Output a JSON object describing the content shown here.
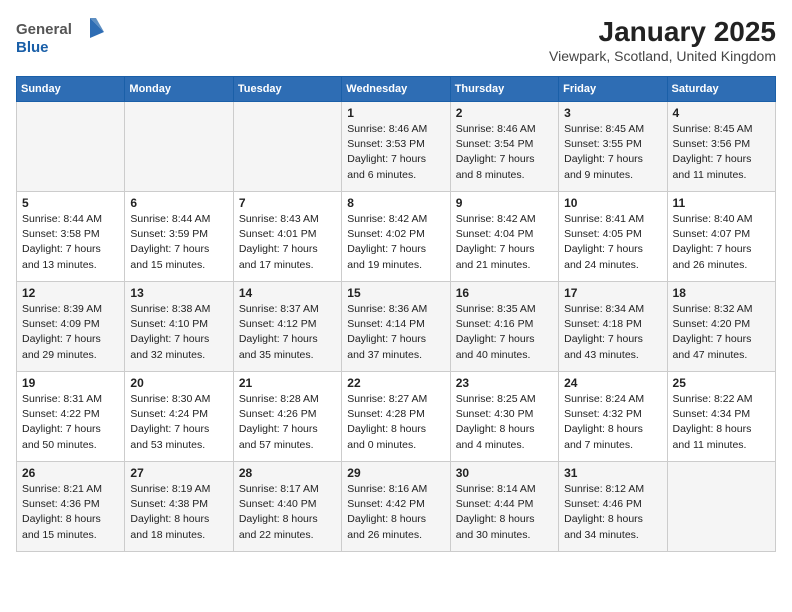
{
  "header": {
    "title": "January 2025",
    "subtitle": "Viewpark, Scotland, United Kingdom",
    "logo_line1": "General",
    "logo_line2": "Blue"
  },
  "days_of_week": [
    "Sunday",
    "Monday",
    "Tuesday",
    "Wednesday",
    "Thursday",
    "Friday",
    "Saturday"
  ],
  "weeks": [
    [
      {
        "day": "",
        "sunrise": "",
        "sunset": "",
        "daylight": ""
      },
      {
        "day": "",
        "sunrise": "",
        "sunset": "",
        "daylight": ""
      },
      {
        "day": "",
        "sunrise": "",
        "sunset": "",
        "daylight": ""
      },
      {
        "day": "1",
        "sunrise": "Sunrise: 8:46 AM",
        "sunset": "Sunset: 3:53 PM",
        "daylight": "Daylight: 7 hours and 6 minutes."
      },
      {
        "day": "2",
        "sunrise": "Sunrise: 8:46 AM",
        "sunset": "Sunset: 3:54 PM",
        "daylight": "Daylight: 7 hours and 8 minutes."
      },
      {
        "day": "3",
        "sunrise": "Sunrise: 8:45 AM",
        "sunset": "Sunset: 3:55 PM",
        "daylight": "Daylight: 7 hours and 9 minutes."
      },
      {
        "day": "4",
        "sunrise": "Sunrise: 8:45 AM",
        "sunset": "Sunset: 3:56 PM",
        "daylight": "Daylight: 7 hours and 11 minutes."
      }
    ],
    [
      {
        "day": "5",
        "sunrise": "Sunrise: 8:44 AM",
        "sunset": "Sunset: 3:58 PM",
        "daylight": "Daylight: 7 hours and 13 minutes."
      },
      {
        "day": "6",
        "sunrise": "Sunrise: 8:44 AM",
        "sunset": "Sunset: 3:59 PM",
        "daylight": "Daylight: 7 hours and 15 minutes."
      },
      {
        "day": "7",
        "sunrise": "Sunrise: 8:43 AM",
        "sunset": "Sunset: 4:01 PM",
        "daylight": "Daylight: 7 hours and 17 minutes."
      },
      {
        "day": "8",
        "sunrise": "Sunrise: 8:42 AM",
        "sunset": "Sunset: 4:02 PM",
        "daylight": "Daylight: 7 hours and 19 minutes."
      },
      {
        "day": "9",
        "sunrise": "Sunrise: 8:42 AM",
        "sunset": "Sunset: 4:04 PM",
        "daylight": "Daylight: 7 hours and 21 minutes."
      },
      {
        "day": "10",
        "sunrise": "Sunrise: 8:41 AM",
        "sunset": "Sunset: 4:05 PM",
        "daylight": "Daylight: 7 hours and 24 minutes."
      },
      {
        "day": "11",
        "sunrise": "Sunrise: 8:40 AM",
        "sunset": "Sunset: 4:07 PM",
        "daylight": "Daylight: 7 hours and 26 minutes."
      }
    ],
    [
      {
        "day": "12",
        "sunrise": "Sunrise: 8:39 AM",
        "sunset": "Sunset: 4:09 PM",
        "daylight": "Daylight: 7 hours and 29 minutes."
      },
      {
        "day": "13",
        "sunrise": "Sunrise: 8:38 AM",
        "sunset": "Sunset: 4:10 PM",
        "daylight": "Daylight: 7 hours and 32 minutes."
      },
      {
        "day": "14",
        "sunrise": "Sunrise: 8:37 AM",
        "sunset": "Sunset: 4:12 PM",
        "daylight": "Daylight: 7 hours and 35 minutes."
      },
      {
        "day": "15",
        "sunrise": "Sunrise: 8:36 AM",
        "sunset": "Sunset: 4:14 PM",
        "daylight": "Daylight: 7 hours and 37 minutes."
      },
      {
        "day": "16",
        "sunrise": "Sunrise: 8:35 AM",
        "sunset": "Sunset: 4:16 PM",
        "daylight": "Daylight: 7 hours and 40 minutes."
      },
      {
        "day": "17",
        "sunrise": "Sunrise: 8:34 AM",
        "sunset": "Sunset: 4:18 PM",
        "daylight": "Daylight: 7 hours and 43 minutes."
      },
      {
        "day": "18",
        "sunrise": "Sunrise: 8:32 AM",
        "sunset": "Sunset: 4:20 PM",
        "daylight": "Daylight: 7 hours and 47 minutes."
      }
    ],
    [
      {
        "day": "19",
        "sunrise": "Sunrise: 8:31 AM",
        "sunset": "Sunset: 4:22 PM",
        "daylight": "Daylight: 7 hours and 50 minutes."
      },
      {
        "day": "20",
        "sunrise": "Sunrise: 8:30 AM",
        "sunset": "Sunset: 4:24 PM",
        "daylight": "Daylight: 7 hours and 53 minutes."
      },
      {
        "day": "21",
        "sunrise": "Sunrise: 8:28 AM",
        "sunset": "Sunset: 4:26 PM",
        "daylight": "Daylight: 7 hours and 57 minutes."
      },
      {
        "day": "22",
        "sunrise": "Sunrise: 8:27 AM",
        "sunset": "Sunset: 4:28 PM",
        "daylight": "Daylight: 8 hours and 0 minutes."
      },
      {
        "day": "23",
        "sunrise": "Sunrise: 8:25 AM",
        "sunset": "Sunset: 4:30 PM",
        "daylight": "Daylight: 8 hours and 4 minutes."
      },
      {
        "day": "24",
        "sunrise": "Sunrise: 8:24 AM",
        "sunset": "Sunset: 4:32 PM",
        "daylight": "Daylight: 8 hours and 7 minutes."
      },
      {
        "day": "25",
        "sunrise": "Sunrise: 8:22 AM",
        "sunset": "Sunset: 4:34 PM",
        "daylight": "Daylight: 8 hours and 11 minutes."
      }
    ],
    [
      {
        "day": "26",
        "sunrise": "Sunrise: 8:21 AM",
        "sunset": "Sunset: 4:36 PM",
        "daylight": "Daylight: 8 hours and 15 minutes."
      },
      {
        "day": "27",
        "sunrise": "Sunrise: 8:19 AM",
        "sunset": "Sunset: 4:38 PM",
        "daylight": "Daylight: 8 hours and 18 minutes."
      },
      {
        "day": "28",
        "sunrise": "Sunrise: 8:17 AM",
        "sunset": "Sunset: 4:40 PM",
        "daylight": "Daylight: 8 hours and 22 minutes."
      },
      {
        "day": "29",
        "sunrise": "Sunrise: 8:16 AM",
        "sunset": "Sunset: 4:42 PM",
        "daylight": "Daylight: 8 hours and 26 minutes."
      },
      {
        "day": "30",
        "sunrise": "Sunrise: 8:14 AM",
        "sunset": "Sunset: 4:44 PM",
        "daylight": "Daylight: 8 hours and 30 minutes."
      },
      {
        "day": "31",
        "sunrise": "Sunrise: 8:12 AM",
        "sunset": "Sunset: 4:46 PM",
        "daylight": "Daylight: 8 hours and 34 minutes."
      },
      {
        "day": "",
        "sunrise": "",
        "sunset": "",
        "daylight": ""
      }
    ]
  ]
}
